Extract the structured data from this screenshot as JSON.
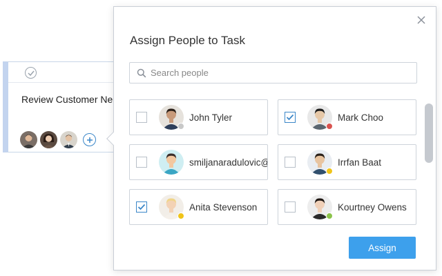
{
  "task_card": {
    "title": "Review Customer Ne",
    "assignees": [
      {
        "icon": "avatar-man-dark-hair",
        "bg": "#7a6e66"
      },
      {
        "icon": "avatar-woman-dark-hair",
        "bg": "#5a4a40"
      },
      {
        "icon": "avatar-man-suit",
        "bg": "#d8d4cc"
      }
    ],
    "add_icon": "plus-circle-icon"
  },
  "popup": {
    "title": "Assign People to Task",
    "search": {
      "placeholder": "Search people",
      "value": ""
    },
    "people": [
      {
        "name": "John Tyler",
        "checked": false,
        "status": "#c8c8c8",
        "skin": "#c89a7a",
        "hair": "#2a1f18",
        "shirt": "#2d3e5a",
        "bg": "#e6e2dc"
      },
      {
        "name": "Mark Choo",
        "checked": true,
        "status": "#d9534f",
        "skin": "#e6c8a8",
        "hair": "#1c1c1c",
        "shirt": "#5a6670",
        "bg": "#e8e8e8"
      },
      {
        "name": "smiljanaradulovic@y",
        "checked": false,
        "status": null,
        "skin": "#f2c8a0",
        "hair": "#3a2e2a",
        "shirt": "#3aa6c4",
        "bg": "#cfeef2"
      },
      {
        "name": "Irrfan Baat",
        "checked": false,
        "status": "#f0c419",
        "skin": "#e8c4a0",
        "hair": "#2a211a",
        "shirt": "#31506e",
        "bg": "#e9edf2"
      },
      {
        "name": "Anita Stevenson",
        "checked": true,
        "status": "#f0c419",
        "skin": "#f3d2b5",
        "hair": "#f0d58a",
        "shirt": "#f5f0ea",
        "bg": "#f2eee8"
      },
      {
        "name": "Kourtney Owens",
        "checked": false,
        "status": "#8bc34a",
        "skin": "#f0d0b8",
        "hair": "#1e1612",
        "shirt": "#2a2a2a",
        "bg": "#ededed"
      }
    ],
    "assign_label": "Assign",
    "colors": {
      "accent": "#3da0ec",
      "check": "#3a86c8"
    }
  }
}
